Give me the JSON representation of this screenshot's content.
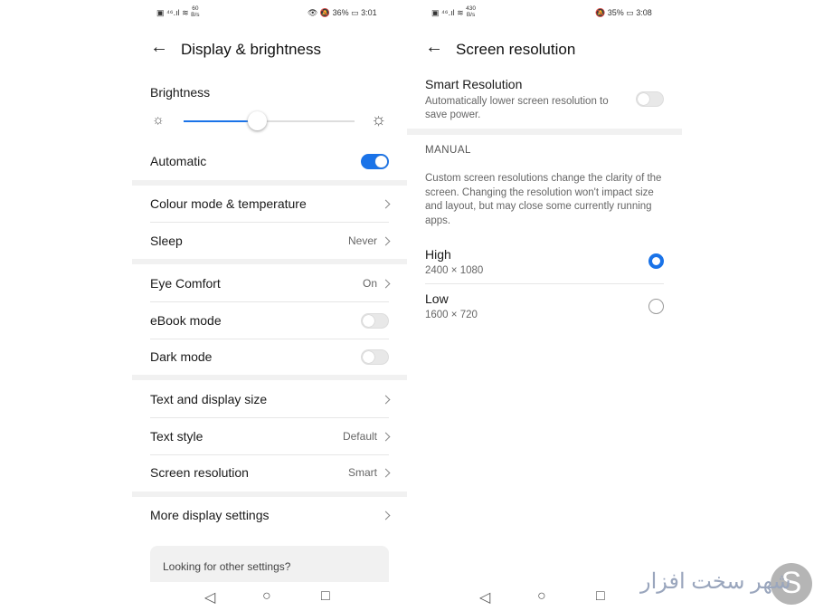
{
  "left": {
    "status": {
      "speed": "60",
      "speed_unit": "B/s",
      "battery": "36%",
      "time": "3:01"
    },
    "title": "Display & brightness",
    "brightness": {
      "label": "Brightness",
      "level": 0.43
    },
    "automatic": {
      "label": "Automatic",
      "on": true
    },
    "rows": [
      {
        "label": "Colour mode & temperature",
        "value": ""
      },
      {
        "label": "Sleep",
        "value": "Never"
      },
      {
        "label": "Eye Comfort",
        "value": "On"
      },
      {
        "label": "eBook mode",
        "toggle": false
      },
      {
        "label": "Dark mode",
        "toggle": false
      },
      {
        "label": "Text and display size",
        "value": ""
      },
      {
        "label": "Text style",
        "value": "Default"
      },
      {
        "label": "Screen resolution",
        "value": "Smart"
      },
      {
        "label": "More display settings",
        "value": ""
      }
    ],
    "search_card": "Looking for other settings?"
  },
  "right": {
    "status": {
      "speed": "430",
      "speed_unit": "B/s",
      "battery": "35%",
      "time": "3:08"
    },
    "title": "Screen resolution",
    "smart": {
      "label": "Smart Resolution",
      "desc": "Automatically lower screen resolution to save power.",
      "on": false
    },
    "section": "MANUAL",
    "info": "Custom screen resolutions change the clarity of the screen. Changing the resolution won't impact size and layout, but may close some currently running apps.",
    "options": [
      {
        "label": "High",
        "res": "2400 × 1080",
        "selected": true
      },
      {
        "label": "Low",
        "res": "1600 × 720",
        "selected": false
      }
    ]
  },
  "watermark": "شهر سخت افزار",
  "colors": {
    "accent": "#1a73e8"
  }
}
